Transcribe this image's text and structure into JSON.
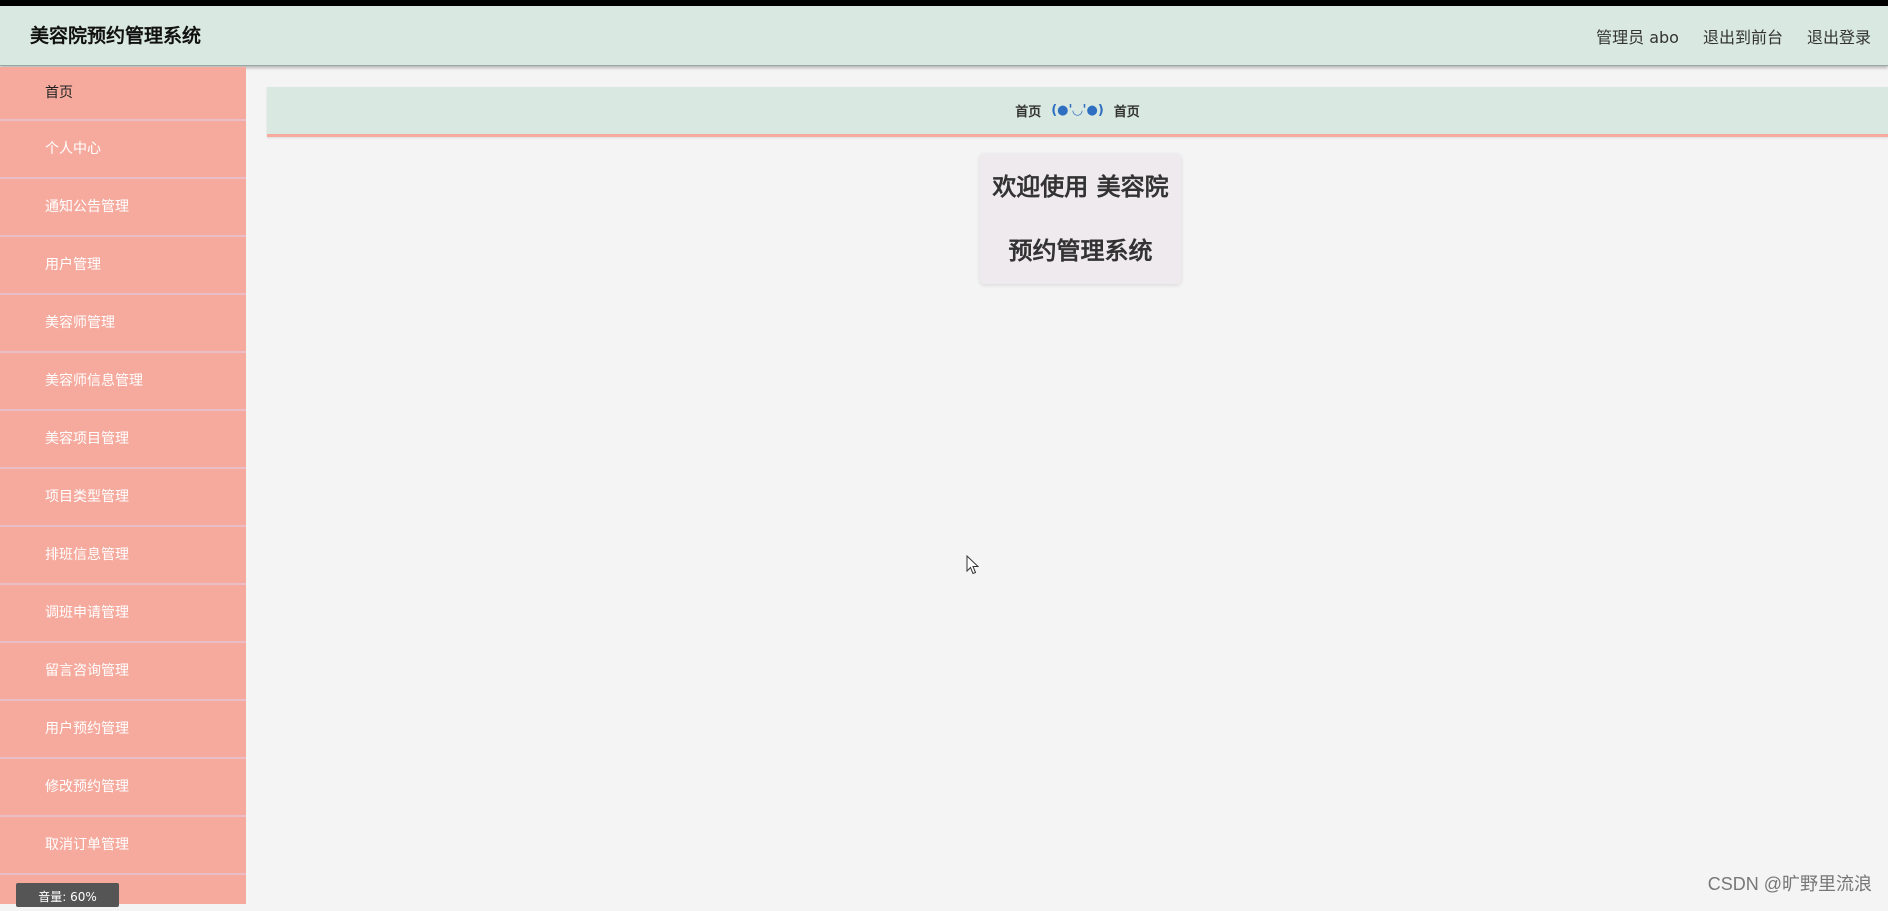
{
  "header": {
    "title": "美容院预约管理系统",
    "admin_label": "管理员 abo",
    "logout_front": "退出到前台",
    "logout": "退出登录"
  },
  "sidebar": {
    "items": [
      {
        "label": "首页"
      },
      {
        "label": "个人中心"
      },
      {
        "label": "通知公告管理"
      },
      {
        "label": "用户管理"
      },
      {
        "label": "美容师管理"
      },
      {
        "label": "美容师信息管理"
      },
      {
        "label": "美容项目管理"
      },
      {
        "label": "项目类型管理"
      },
      {
        "label": "排班信息管理"
      },
      {
        "label": "调班申请管理"
      },
      {
        "label": "留言咨询管理"
      },
      {
        "label": "用户预约管理"
      },
      {
        "label": "修改预约管理"
      },
      {
        "label": "取消订单管理"
      }
    ]
  },
  "breadcrumb": {
    "home": "首页",
    "separator": "(●'◡'●)",
    "current": "首页"
  },
  "welcome": {
    "text": "欢迎使用 美容院预约管理系统"
  },
  "overlay": {
    "watermark": "CSDN @旷野里流浪",
    "volume": "音量: 60%"
  },
  "colors": {
    "header_bg": "#d9e8e1",
    "sidebar_bg": "#f6aa9e",
    "accent_blue": "#2f6fc2"
  }
}
